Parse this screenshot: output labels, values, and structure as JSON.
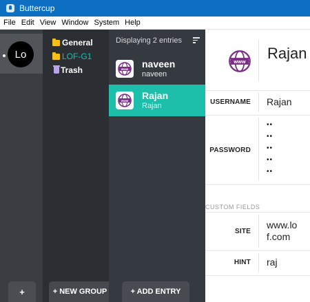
{
  "window": {
    "title": "Buttercup"
  },
  "menu": [
    "File",
    "Edit",
    "View",
    "Window",
    "System",
    "Help"
  ],
  "archives": {
    "avatar_text": "Lo",
    "add_label": "+"
  },
  "groups": {
    "items": [
      {
        "label": "General",
        "icon": "folder-icon"
      },
      {
        "label": "LOF-G1",
        "icon": "folder-icon"
      },
      {
        "label": "Trash",
        "icon": "trash-icon"
      }
    ],
    "new_group_label": "+ NEW GROUP"
  },
  "entries": {
    "header": "Displaying 2 entries",
    "items": [
      {
        "title": "naveen",
        "subtitle": "naveen",
        "icon": "globe-icon"
      },
      {
        "title": "Rajan",
        "subtitle": "Rajan",
        "icon": "globe-icon"
      }
    ],
    "add_entry_label": "+ ADD ENTRY"
  },
  "details": {
    "title": "Rajan",
    "icon": "globe-icon",
    "fields": {
      "username": {
        "label": "USERNAME",
        "value": "Rajan"
      },
      "password": {
        "label": "PASSWORD",
        "dots": [
          "••",
          "••",
          "••",
          "••",
          "••"
        ]
      }
    },
    "custom_heading": "CUSTOM FIELDS",
    "custom_fields": {
      "site": {
        "label": "SITE",
        "value_line1": "www.lo",
        "value_line2": "f.com"
      },
      "hint": {
        "label": "HINT",
        "value": "raj"
      }
    }
  },
  "colors": {
    "titlebar": "#0c6fc1",
    "accent": "#1ebfaa",
    "folder": "#f4c21b",
    "trash": "#b9a4e8",
    "globe": "#7b2e86"
  }
}
